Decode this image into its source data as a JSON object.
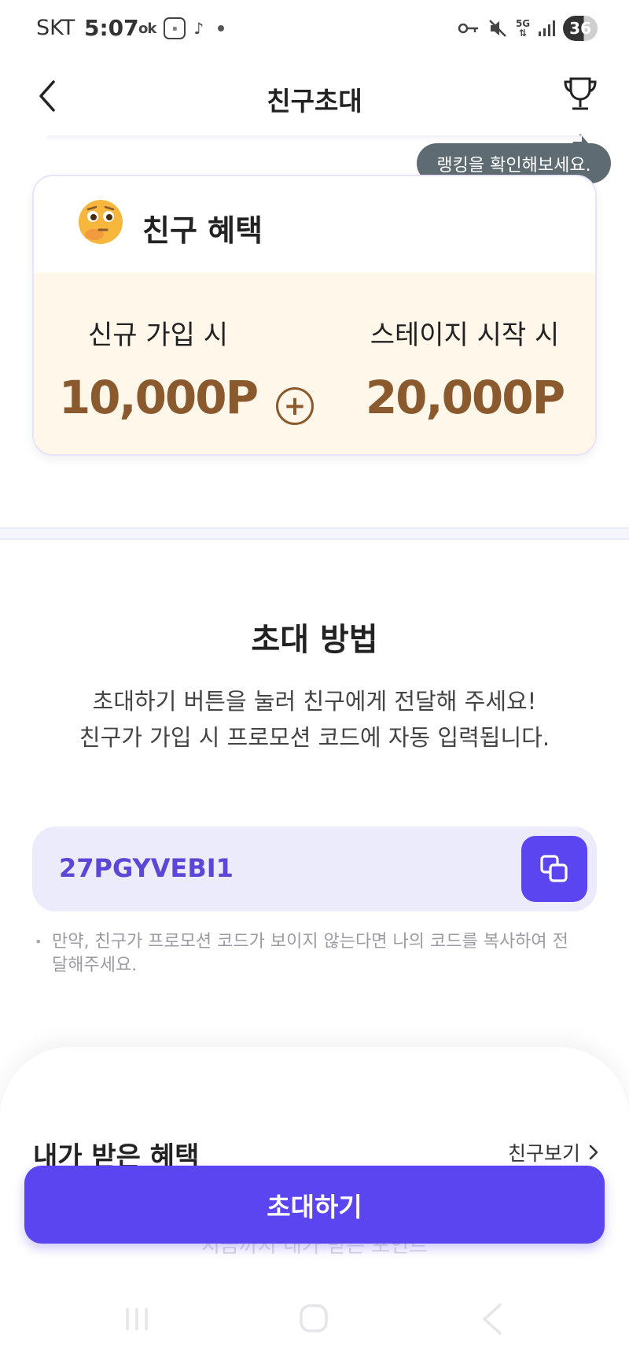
{
  "status_bar": {
    "carrier": "SKT",
    "time": "5:07",
    "ok_label": "ok",
    "battery": "36",
    "network": "5G"
  },
  "header": {
    "title": "친구초대",
    "tooltip": "랭킹을 확인해보세요."
  },
  "benefit": {
    "title": "친구 혜택",
    "signup_label": "신규 가입 시",
    "signup_value": "10,000P",
    "stage_label": "스테이지 시작 시",
    "stage_value": "20,000P"
  },
  "method": {
    "title": "초대 방법",
    "desc_line1": "초대하기 버튼을 눌러 친구에게 전달해 주세요!",
    "desc_line2": "친구가 가입 시 프로모션 코드에 자동 입력됩니다."
  },
  "promo": {
    "code": "27PGYVEBI1",
    "note": "만약, 친구가 프로모션 코드가 보이지 않는다면 나의 코드를 복사하여 전달해주세요."
  },
  "received": {
    "title": "내가 받은 혜택",
    "friends_link": "친구보기",
    "faded_text": "지금까지 내가 받은 포인트"
  },
  "invite_button": "초대하기",
  "colors": {
    "primary": "#5b45f0",
    "code_bg": "#ecebfb",
    "benefit_bg": "#fff7e9",
    "benefit_value": "#8a5a2e",
    "tooltip_bg": "#5f6b73"
  }
}
